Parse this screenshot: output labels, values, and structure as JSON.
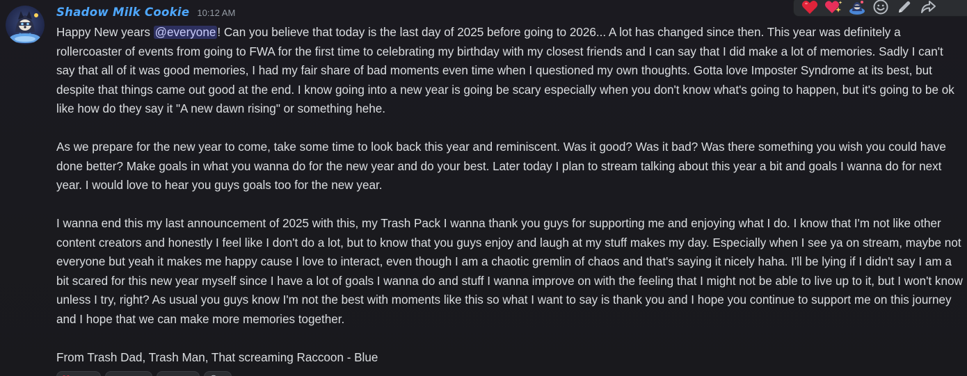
{
  "message": {
    "author": "Shadow Milk Cookie",
    "timestamp": "10:12 AM",
    "accent_color": "#4fa8ff",
    "mention": "@everyone",
    "paragraphs": [
      {
        "before_mention": "Happy New years ",
        "after_mention": "! Can you believe that today is the last day of 2025 before going to 2026... A lot has changed since then. This year was definitely a rollercoaster of events from going to FWA for the first time to celebrating my birthday with my closest friends and I can say that I did make a lot of memories. Sadly I can't say that all of it was good memories, I had my fair share of bad moments even time when I questioned my own thoughts. Gotta love Imposter Syndrome at its best, but despite that things came out good at the end. I know going into a new year is going be scary especially when you don't know what's going to happen, but it's going to be ok like how do they say it \"A new dawn rising\" or something hehe."
      },
      {
        "text": "As we prepare for the new year to come, take some time to look back this year and reminiscent. Was it good? Was it bad? Was there something you wish you could have done better? Make goals in what you wanna do for the new year and do your best. Later today I plan to stream talking about this year a bit and goals I wanna do for next year. I would love to hear you guys goals too for the new year."
      },
      {
        "text": "I wanna end this my last announcement of 2025 with this, my Trash Pack I wanna thank you guys for supporting me and enjoying what I do. I know that I'm not like other content creators and honestly I feel like I don't do a lot, but to know that you guys enjoy and laugh at my stuff makes my day. Especially when I see ya on stream, maybe not everyone but yeah it makes me happy cause I love to interact, even though I am a chaotic gremlin of chaos and that's saying it nicely haha. I'll be lying if I didn't say I am a bit scared for this new year myself since I have a lot of goals I wanna do and stuff I wanna improve on with the feeling that I might not be able to live up to it, but I won't know unless I try, right? As usual you guys know I'm not the best with moments like this so what I want to say is thank you and I hope you continue to support me on this journey and I hope that we can make more memories together."
      },
      {
        "text": "From Trash Dad, Trash Man, That screaming Raccoon - Blue"
      }
    ]
  },
  "toolbar": {
    "buttons": [
      {
        "icon": "heart-reaction-icon"
      },
      {
        "icon": "sparkling-heart-reaction-icon"
      },
      {
        "icon": "custom-emoji-reaction-icon"
      },
      {
        "icon": "add-reaction-icon"
      },
      {
        "icon": "edit-pencil-icon"
      },
      {
        "icon": "reply-arrow-icon"
      }
    ]
  },
  "reactions": [
    {
      "icon": "heart-reaction-icon"
    },
    {
      "icon": "custom-emoji-reaction-icon"
    },
    {
      "icon": "custom-emoji-reaction-icon"
    }
  ]
}
